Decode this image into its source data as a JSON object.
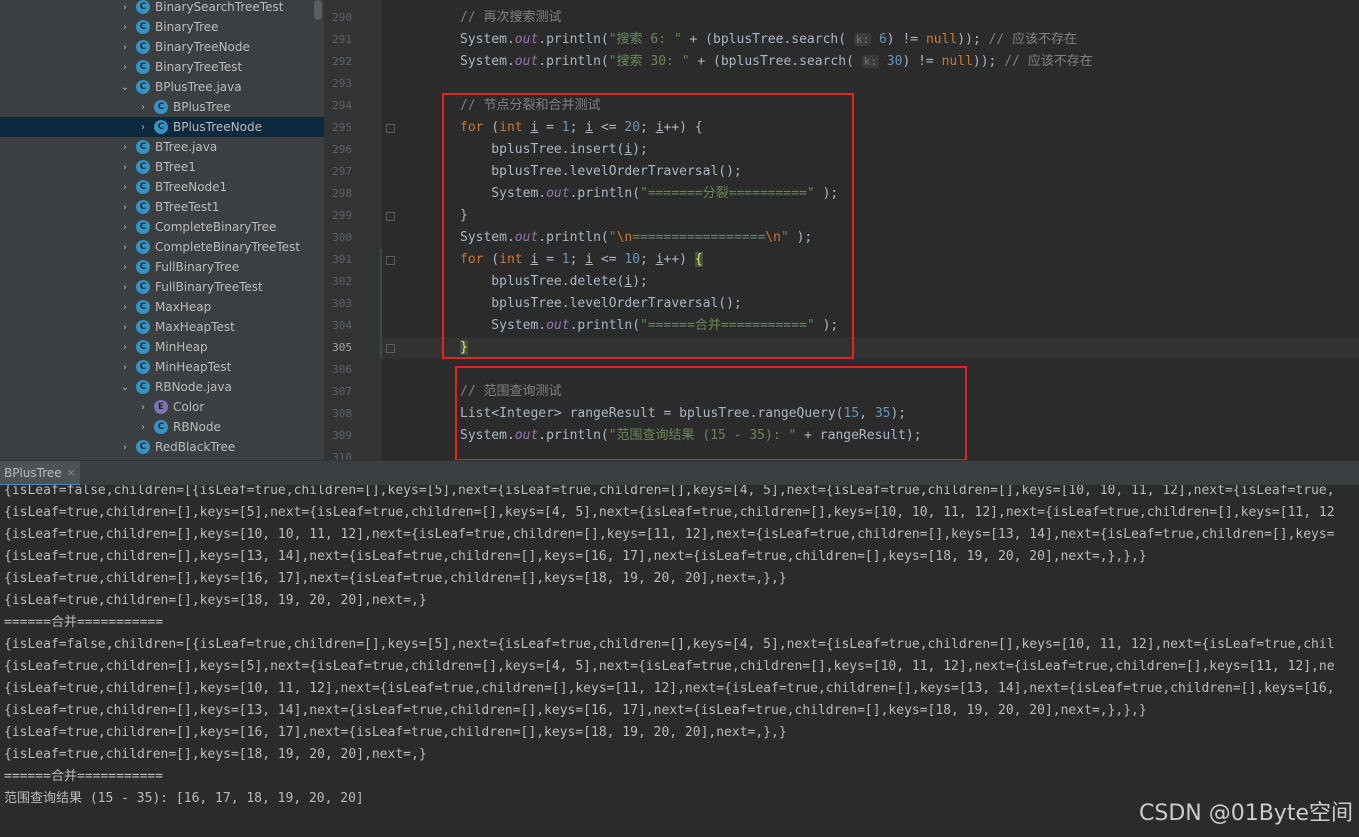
{
  "project_tree": {
    "items": [
      {
        "label": "BinarySearchTreeTest",
        "indent": 1,
        "icon": "class-icon",
        "arrow": "›",
        "selected": false
      },
      {
        "label": "BinaryTree",
        "indent": 1,
        "icon": "class-icon",
        "arrow": "›",
        "selected": false
      },
      {
        "label": "BinaryTreeNode",
        "indent": 1,
        "icon": "class-icon",
        "arrow": "›",
        "selected": false
      },
      {
        "label": "BinaryTreeTest",
        "indent": 1,
        "icon": "class-icon",
        "arrow": "›",
        "selected": false
      },
      {
        "label": "BPlusTree.java",
        "indent": 1,
        "icon": "class-icon",
        "arrow": "⌄",
        "selected": false
      },
      {
        "label": "BPlusTree",
        "indent": 2,
        "icon": "class-icon",
        "arrow": "›",
        "selected": false
      },
      {
        "label": "BPlusTreeNode",
        "indent": 2,
        "icon": "class-icon",
        "arrow": "›",
        "selected": true
      },
      {
        "label": "BTree.java",
        "indent": 1,
        "icon": "class-icon",
        "arrow": "›",
        "selected": false
      },
      {
        "label": "BTree1",
        "indent": 1,
        "icon": "class-icon",
        "arrow": "›",
        "selected": false
      },
      {
        "label": "BTreeNode1",
        "indent": 1,
        "icon": "class-icon",
        "arrow": "›",
        "selected": false
      },
      {
        "label": "BTreeTest1",
        "indent": 1,
        "icon": "class-icon",
        "arrow": "›",
        "selected": false
      },
      {
        "label": "CompleteBinaryTree",
        "indent": 1,
        "icon": "class-icon",
        "arrow": "›",
        "selected": false
      },
      {
        "label": "CompleteBinaryTreeTest",
        "indent": 1,
        "icon": "class-icon",
        "arrow": "›",
        "selected": false
      },
      {
        "label": "FullBinaryTree",
        "indent": 1,
        "icon": "class-icon",
        "arrow": "›",
        "selected": false
      },
      {
        "label": "FullBinaryTreeTest",
        "indent": 1,
        "icon": "class-icon",
        "arrow": "›",
        "selected": false
      },
      {
        "label": "MaxHeap",
        "indent": 1,
        "icon": "class-icon",
        "arrow": "›",
        "selected": false
      },
      {
        "label": "MaxHeapTest",
        "indent": 1,
        "icon": "class-icon",
        "arrow": "›",
        "selected": false
      },
      {
        "label": "MinHeap",
        "indent": 1,
        "icon": "class-icon",
        "arrow": "›",
        "selected": false
      },
      {
        "label": "MinHeapTest",
        "indent": 1,
        "icon": "class-icon",
        "arrow": "›",
        "selected": false
      },
      {
        "label": "RBNode.java",
        "indent": 1,
        "icon": "class-icon",
        "arrow": "⌄",
        "selected": false
      },
      {
        "label": "Color",
        "indent": 2,
        "icon": "enum-icon",
        "arrow": "›",
        "selected": false
      },
      {
        "label": "RBNode",
        "indent": 2,
        "icon": "class-icon",
        "arrow": "›",
        "selected": false
      },
      {
        "label": "RedBlackTree",
        "indent": 1,
        "icon": "class-icon",
        "arrow": "›",
        "selected": false
      }
    ]
  },
  "editor": {
    "current_line": 305,
    "lines": [
      {
        "num": 290,
        "segments": [
          [
            "c-comment",
            "// 再次搜索测试"
          ]
        ]
      },
      {
        "num": 291,
        "segments": [
          [
            "",
            "System."
          ],
          [
            "c-field",
            "out"
          ],
          [
            "",
            ".println("
          ],
          [
            "c-str",
            "\"搜索 6: \""
          ],
          [
            "",
            " + (bplusTree.search( "
          ],
          [
            "c-hint",
            "k:"
          ],
          [
            "c-num",
            " 6"
          ],
          [
            "",
            ") != "
          ],
          [
            "c-kw",
            "null"
          ],
          [
            "",
            ")); "
          ],
          [
            "c-comment",
            "// 应该不存在"
          ]
        ]
      },
      {
        "num": 292,
        "segments": [
          [
            "",
            "System."
          ],
          [
            "c-field",
            "out"
          ],
          [
            "",
            ".println("
          ],
          [
            "c-str",
            "\"搜索 30: \""
          ],
          [
            "",
            " + (bplusTree.search( "
          ],
          [
            "c-hint",
            "k:"
          ],
          [
            "c-num",
            " 30"
          ],
          [
            "",
            ") != "
          ],
          [
            "c-kw",
            "null"
          ],
          [
            "",
            ")); "
          ],
          [
            "c-comment",
            "// 应该不存在"
          ]
        ]
      },
      {
        "num": 293,
        "segments": []
      },
      {
        "num": 294,
        "segments": [
          [
            "c-comment",
            "// 节点分裂和合并测试"
          ]
        ]
      },
      {
        "num": 295,
        "segments": [
          [
            "c-kw",
            "for"
          ],
          [
            "",
            " ("
          ],
          [
            "c-kw",
            "int"
          ],
          [
            "",
            " "
          ],
          [
            "c-under",
            "i"
          ],
          [
            "",
            " = "
          ],
          [
            "c-num",
            "1"
          ],
          [
            "",
            "; "
          ],
          [
            "c-under",
            "i"
          ],
          [
            "",
            " <= "
          ],
          [
            "c-num",
            "20"
          ],
          [
            "",
            "; "
          ],
          [
            "c-under",
            "i"
          ],
          [
            "",
            "++) {"
          ]
        ]
      },
      {
        "num": 296,
        "segments": [
          [
            "",
            "    bplusTree.insert("
          ],
          [
            "c-under",
            "i"
          ],
          [
            "",
            ");"
          ]
        ]
      },
      {
        "num": 297,
        "segments": [
          [
            "",
            "    bplusTree.levelOrderTraversal();"
          ]
        ]
      },
      {
        "num": 298,
        "segments": [
          [
            "",
            "    System."
          ],
          [
            "c-field",
            "out"
          ],
          [
            "",
            ".println("
          ],
          [
            "c-str",
            "\"=======分裂==========\""
          ],
          [
            "",
            " );"
          ]
        ]
      },
      {
        "num": 299,
        "segments": [
          [
            "",
            "}"
          ]
        ]
      },
      {
        "num": 300,
        "segments": [
          [
            "",
            "System."
          ],
          [
            "c-field",
            "out"
          ],
          [
            "",
            ".println("
          ],
          [
            "c-str",
            "\""
          ],
          [
            "c-escape",
            "\\n"
          ],
          [
            "c-str",
            "================="
          ],
          [
            "c-escape",
            "\\n"
          ],
          [
            "c-str",
            "\""
          ],
          [
            "",
            " );"
          ]
        ]
      },
      {
        "num": 301,
        "segments": [
          [
            "c-kw",
            "for"
          ],
          [
            "",
            " ("
          ],
          [
            "c-kw",
            "int"
          ],
          [
            "",
            " "
          ],
          [
            "c-under",
            "i"
          ],
          [
            "",
            " = "
          ],
          [
            "c-num",
            "1"
          ],
          [
            "",
            "; "
          ],
          [
            "c-under",
            "i"
          ],
          [
            "",
            " <= "
          ],
          [
            "c-num",
            "10"
          ],
          [
            "",
            "; "
          ],
          [
            "c-under",
            "i"
          ],
          [
            "",
            "++) "
          ],
          [
            "c-brace",
            "{"
          ]
        ]
      },
      {
        "num": 302,
        "segments": [
          [
            "",
            "    bplusTree.delete("
          ],
          [
            "c-under",
            "i"
          ],
          [
            "",
            ");"
          ]
        ]
      },
      {
        "num": 303,
        "segments": [
          [
            "",
            "    bplusTree.levelOrderTraversal();"
          ]
        ]
      },
      {
        "num": 304,
        "segments": [
          [
            "",
            "    System."
          ],
          [
            "c-field",
            "out"
          ],
          [
            "",
            ".println("
          ],
          [
            "c-str",
            "\"======合并===========\""
          ],
          [
            "",
            " );"
          ]
        ]
      },
      {
        "num": 305,
        "segments": [
          [
            "c-brace",
            "}"
          ]
        ]
      },
      {
        "num": 306,
        "segments": []
      },
      {
        "num": 307,
        "segments": [
          [
            "c-comment",
            "// 范围查询测试"
          ]
        ]
      },
      {
        "num": 308,
        "segments": [
          [
            "",
            "List<Integer> rangeResult = bplusTree.rangeQuery("
          ],
          [
            "c-num",
            "15"
          ],
          [
            "",
            ", "
          ],
          [
            "c-num",
            "35"
          ],
          [
            "",
            ");"
          ]
        ]
      },
      {
        "num": 309,
        "segments": [
          [
            "",
            "System."
          ],
          [
            "c-field",
            "out"
          ],
          [
            "",
            ".println("
          ],
          [
            "c-str",
            "\"范围查询结果 (15 - 35): \""
          ],
          [
            "",
            " + rangeResult);"
          ]
        ]
      },
      {
        "num": 310,
        "segments": []
      }
    ]
  },
  "run_panel": {
    "tab_label": "BPlusTree",
    "close_glyph": "×",
    "lines": [
      "{isLeaf=false,children=[{isLeaf=true,children=[],keys=[5],next={isLeaf=true,children=[],keys=[4, 5],next={isLeaf=true,children=[],keys=[10, 10, 11, 12],next={isLeaf=true,",
      "{isLeaf=true,children=[],keys=[5],next={isLeaf=true,children=[],keys=[4, 5],next={isLeaf=true,children=[],keys=[10, 10, 11, 12],next={isLeaf=true,children=[],keys=[11, 12",
      "{isLeaf=true,children=[],keys=[10, 10, 11, 12],next={isLeaf=true,children=[],keys=[11, 12],next={isLeaf=true,children=[],keys=[13, 14],next={isLeaf=true,children=[],keys=",
      "{isLeaf=true,children=[],keys=[13, 14],next={isLeaf=true,children=[],keys=[16, 17],next={isLeaf=true,children=[],keys=[18, 19, 20, 20],next=,},},}",
      "{isLeaf=true,children=[],keys=[16, 17],next={isLeaf=true,children=[],keys=[18, 19, 20, 20],next=,},}",
      "{isLeaf=true,children=[],keys=[18, 19, 20, 20],next=,}",
      "======合并===========",
      "{isLeaf=false,children=[{isLeaf=true,children=[],keys=[5],next={isLeaf=true,children=[],keys=[4, 5],next={isLeaf=true,children=[],keys=[10, 11, 12],next={isLeaf=true,chil",
      "{isLeaf=true,children=[],keys=[5],next={isLeaf=true,children=[],keys=[4, 5],next={isLeaf=true,children=[],keys=[10, 11, 12],next={isLeaf=true,children=[],keys=[11, 12],ne",
      "{isLeaf=true,children=[],keys=[10, 11, 12],next={isLeaf=true,children=[],keys=[11, 12],next={isLeaf=true,children=[],keys=[13, 14],next={isLeaf=true,children=[],keys=[16,",
      "{isLeaf=true,children=[],keys=[13, 14],next={isLeaf=true,children=[],keys=[16, 17],next={isLeaf=true,children=[],keys=[18, 19, 20, 20],next=,},},}",
      "{isLeaf=true,children=[],keys=[16, 17],next={isLeaf=true,children=[],keys=[18, 19, 20, 20],next=,},}",
      "{isLeaf=true,children=[],keys=[18, 19, 20, 20],next=,}",
      "======合并===========",
      "范围查询结果 (15 - 35): [16, 17, 18, 19, 20, 20]"
    ]
  },
  "watermark": "CSDN @01Byte空间",
  "colors": {
    "highlight_box": "#e52121",
    "selected_row": "#0d293e",
    "class_icon": "#3592c4",
    "enum_icon": "#8074b8"
  }
}
